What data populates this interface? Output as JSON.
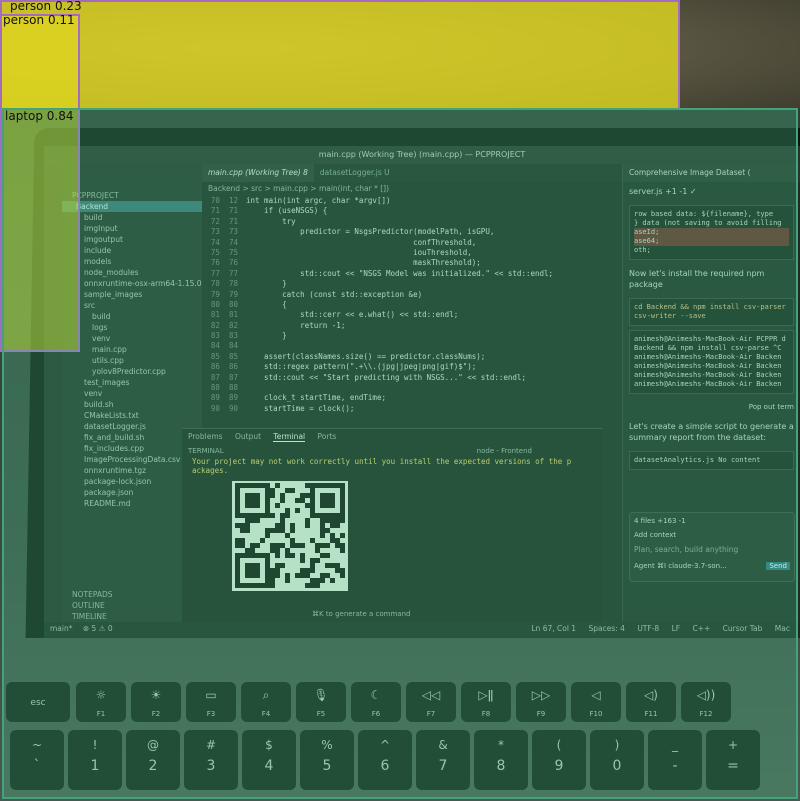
{
  "detections": [
    {
      "label": "person 0.23",
      "color": "#a56bc4"
    },
    {
      "label": "person 0.11",
      "color": "#a56bc4"
    },
    {
      "label": "laptop 0.84",
      "color": "#43a47a"
    }
  ],
  "window": {
    "title": "main.cpp (Working Tree) (main.cpp) — PCPPROJECT"
  },
  "sidebar": {
    "root": "PCPPROJECT",
    "items": [
      "Backend",
      "build",
      "imgInput",
      "imgoutput",
      "include",
      "models",
      "node_modules",
      "onnxruntime-osx-arm64-1.15.0",
      "sample_images",
      "src",
      "build",
      "logs",
      "venv",
      "main.cpp",
      "utils.cpp",
      "yolov8Predictor.cpp",
      "test_images",
      "venv",
      "build.sh",
      "CMakeLists.txt",
      "datasetLogger.js",
      "fix_and_build.sh",
      "fix_includes.cpp",
      "ImageProcessingData.csv",
      "onnxruntime.tgz",
      "package-lock.json",
      "package.json",
      "README.md"
    ],
    "sections": [
      "NOTEPADS",
      "OUTLINE",
      "TIMELINE"
    ]
  },
  "tabs": [
    "main.cpp (Working Tree) 8",
    "datasetLogger.js U"
  ],
  "breadcrumb": "Backend > src > main.cpp > main(int, char * [])",
  "code_lines": [
    {
      "n": "70  12",
      "t": "int main(int argc, char *argv[])"
    },
    {
      "n": "71  71",
      "t": "    if (useNSGS) {"
    },
    {
      "n": "72  71",
      "t": "        try"
    },
    {
      "n": "73  73",
      "t": "            predictor = NsgsPredictor(modelPath, isGPU,"
    },
    {
      "n": "74  74",
      "t": "                                     confThreshold,"
    },
    {
      "n": "75  75",
      "t": "                                     iouThreshold,"
    },
    {
      "n": "76  76",
      "t": "                                     maskThreshold);"
    },
    {
      "n": "77  77",
      "t": "            std::cout << \"NSGS Model was initialized.\" << std::endl;"
    },
    {
      "n": "78  78",
      "t": "        }"
    },
    {
      "n": "79  79",
      "t": "        catch (const std::exception &e)"
    },
    {
      "n": "80  80",
      "t": "        {"
    },
    {
      "n": "81  81",
      "t": "            std::cerr << e.what() << std::endl;"
    },
    {
      "n": "82  82",
      "t": "            return -1;"
    },
    {
      "n": "83  83",
      "t": "        }"
    },
    {
      "n": "84  84",
      "t": ""
    },
    {
      "n": "85  85",
      "t": "    assert(classNames.size() == predictor.classNums);"
    },
    {
      "n": "86  86",
      "t": "    std::regex pattern(\".+\\\\.(jpg|jpeg|png|gif)$\");"
    },
    {
      "n": "87  87",
      "t": "    std::cout << \"Start predicting with NSGS...\" << std::endl;"
    },
    {
      "n": "88  88",
      "t": ""
    },
    {
      "n": "89  89",
      "t": "    clock_t startTime, endTime;"
    },
    {
      "n": "90  90",
      "t": "    startTime = clock();"
    }
  ],
  "panel": {
    "tabs": [
      "Problems",
      "Output",
      "Terminal",
      "Ports"
    ],
    "terminal_label": "TERMINAL",
    "shell": "node - Frontend",
    "warning": "Your project may not work correctly until you install the expected versions of the p ackages.",
    "hint": "⌘K to generate a command"
  },
  "chat": {
    "header": "Comprehensive Image Dataset (",
    "file": "server.js +1 -1 ✓",
    "code1": "row based data: ${filename}, type",
    "code2": "} data (not saving to avoid filling",
    "code3": "aseId;",
    "code4": "ase64;",
    "code5": "oth;",
    "install": "Now let's install the required npm package",
    "cmd": "cd Backend && npm install csv-parser csv-writer --save",
    "term1": "animesh@Animeshs-MacBook-Air PCPPR d Backend && npm install csv-parse ^C",
    "term2": "animesh@Animeshs-MacBook-Air Backen",
    "term3": "animesh@Animeshs-MacBook-Air Backen",
    "term4": "animesh@Animeshs-MacBook-Air Backen",
    "term5": "animesh@Animeshs-MacBook-Air Backen",
    "popout": "Pop out term",
    "summary": "Let's create a simple script to generate a summary report from the dataset:",
    "analytics_file": "datasetAnalytics.js",
    "analytics_note": "No content",
    "files": "4 files +163 -1",
    "add_context": "Add context",
    "placeholder": "Plan, search, build anything",
    "agent": "Agent ⌘I",
    "model": "claude-3.7-son...",
    "send": "Send"
  },
  "status": {
    "branch": "main*",
    "counts": "⊗ 5 ⚠ 0",
    "position": "Ln 67, Col 1",
    "spaces": "Spaces: 4",
    "encoding": "UTF-8",
    "eol": "LF",
    "lang": "C++",
    "cursor_tab": "Cursor Tab",
    "os": "Mac"
  },
  "keyboard": {
    "row1": [
      {
        "label": "esc",
        "icon": ""
      },
      {
        "label": "F1",
        "icon": "☼"
      },
      {
        "label": "F2",
        "icon": "☀"
      },
      {
        "label": "F3",
        "icon": "▭"
      },
      {
        "label": "F4",
        "icon": "⌕"
      },
      {
        "label": "F5",
        "icon": "🎙"
      },
      {
        "label": "F6",
        "icon": "☾"
      },
      {
        "label": "F7",
        "icon": "◁◁"
      },
      {
        "label": "F8",
        "icon": "▷ǁ"
      },
      {
        "label": "F9",
        "icon": "▷▷"
      },
      {
        "label": "F10",
        "icon": "◁"
      },
      {
        "label": "F11",
        "icon": "◁)"
      },
      {
        "label": "F12",
        "icon": "◁))"
      }
    ],
    "row2": [
      "~",
      "!",
      "@",
      "#",
      "$",
      "%",
      "^",
      "&",
      "*",
      "(",
      ")",
      "_",
      "+"
    ],
    "row2_low": [
      "`",
      "1",
      "2",
      "3",
      "4",
      "5",
      "6",
      "7",
      "8",
      "9",
      "0",
      "-",
      "="
    ]
  }
}
